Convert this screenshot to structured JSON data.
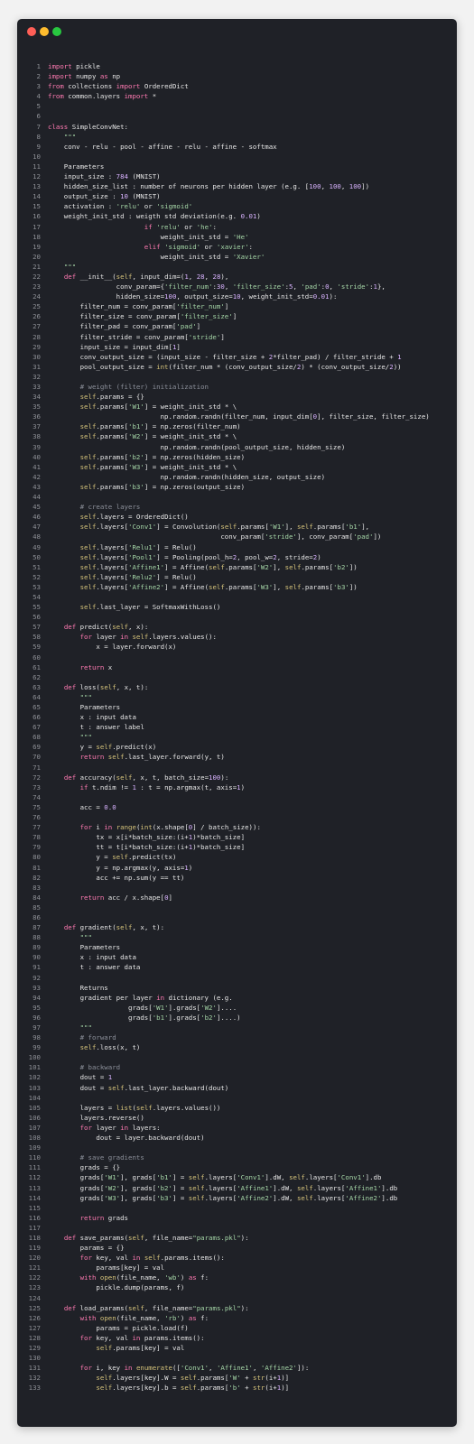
{
  "window": {
    "controls": [
      "close",
      "minimize",
      "zoom"
    ]
  },
  "code": {
    "lines": [
      "import pickle",
      "import numpy as np",
      "from collections import OrderedDict",
      "from common.layers import *",
      "",
      "",
      "class SimpleConvNet:",
      "    \"\"\"",
      "    conv - relu - pool - affine - relu - affine - softmax",
      "",
      "    Parameters",
      "    input_size : 784 (MNIST)",
      "    hidden_size_list : number of neurons per hidden layer (e.g. [100, 100, 100])",
      "    output_size : 10 (MNIST)",
      "    activation : 'relu' or 'sigmoid'",
      "    weight_init_std : weigth std deviation(e.g. 0.01)",
      "                        if 'relu' or 'he':",
      "                            weight_init_std = 'He'",
      "                        elif 'sigmoid' or 'xavier':",
      "                            weight_init_std = 'Xavier'",
      "    \"\"\"",
      "    def __init__(self, input_dim=(1, 28, 28),",
      "                 conv_param={'filter_num':30, 'filter_size':5, 'pad':0, 'stride':1},",
      "                 hidden_size=100, output_size=10, weight_init_std=0.01):",
      "        filter_num = conv_param['filter_num']",
      "        filter_size = conv_param['filter_size']",
      "        filter_pad = conv_param['pad']",
      "        filter_stride = conv_param['stride']",
      "        input_size = input_dim[1]",
      "        conv_output_size = (input_size - filter_size + 2*filter_pad) / filter_stride + 1",
      "        pool_output_size = int(filter_num * (conv_output_size/2) * (conv_output_size/2))",
      "",
      "        # weight (filter) initialization",
      "        self.params = {}",
      "        self.params['W1'] = weight_init_std * \\",
      "                            np.random.randn(filter_num, input_dim[0], filter_size, filter_size)",
      "        self.params['b1'] = np.zeros(filter_num)",
      "        self.params['W2'] = weight_init_std * \\",
      "                            np.random.randn(pool_output_size, hidden_size)",
      "        self.params['b2'] = np.zeros(hidden_size)",
      "        self.params['W3'] = weight_init_std * \\",
      "                            np.random.randn(hidden_size, output_size)",
      "        self.params['b3'] = np.zeros(output_size)",
      "",
      "        # create layers",
      "        self.layers = OrderedDict()",
      "        self.layers['Conv1'] = Convolution(self.params['W1'], self.params['b1'],",
      "                                           conv_param['stride'], conv_param['pad'])",
      "        self.layers['Relu1'] = Relu()",
      "        self.layers['Pool1'] = Pooling(pool_h=2, pool_w=2, stride=2)",
      "        self.layers['Affine1'] = Affine(self.params['W2'], self.params['b2'])",
      "        self.layers['Relu2'] = Relu()",
      "        self.layers['Affine2'] = Affine(self.params['W3'], self.params['b3'])",
      "",
      "        self.last_layer = SoftmaxWithLoss()",
      "",
      "    def predict(self, x):",
      "        for layer in self.layers.values():",
      "            x = layer.forward(x)",
      "",
      "        return x",
      "",
      "    def loss(self, x, t):",
      "        \"\"\"",
      "        Parameters",
      "        x : input data",
      "        t : answer label",
      "        \"\"\"",
      "        y = self.predict(x)",
      "        return self.last_layer.forward(y, t)",
      "",
      "    def accuracy(self, x, t, batch_size=100):",
      "        if t.ndim != 1 : t = np.argmax(t, axis=1)",
      "",
      "        acc = 0.0",
      "",
      "        for i in range(int(x.shape[0] / batch_size)):",
      "            tx = x[i*batch_size:(i+1)*batch_size]",
      "            tt = t[i*batch_size:(i+1)*batch_size]",
      "            y = self.predict(tx)",
      "            y = np.argmax(y, axis=1)",
      "            acc += np.sum(y == tt)",
      "",
      "        return acc / x.shape[0]",
      "",
      "",
      "    def gradient(self, x, t):",
      "        \"\"\"",
      "        Parameters",
      "        x : input data",
      "        t : answer data",
      "",
      "        Returns",
      "        gradient per layer in dictionary (e.g.",
      "                    grads['W1'].grads['W2']....",
      "                    grads['b1'].grads['b2']....)",
      "        \"\"\"",
      "        # forward",
      "        self.loss(x, t)",
      "",
      "        # backward",
      "        dout = 1",
      "        dout = self.last_layer.backward(dout)",
      "",
      "        layers = list(self.layers.values())",
      "        layers.reverse()",
      "        for layer in layers:",
      "            dout = layer.backward(dout)",
      "",
      "        # save gradients",
      "        grads = {}",
      "        grads['W1'], grads['b1'] = self.layers['Conv1'].dW, self.layers['Conv1'].db",
      "        grads['W2'], grads['b2'] = self.layers['Affine1'].dW, self.layers['Affine1'].db",
      "        grads['W3'], grads['b3'] = self.layers['Affine2'].dW, self.layers['Affine2'].db",
      "",
      "        return grads",
      "",
      "    def save_params(self, file_name=\"params.pkl\"):",
      "        params = {}",
      "        for key, val in self.params.items():",
      "            params[key] = val",
      "        with open(file_name, 'wb') as f:",
      "            pickle.dump(params, f)",
      "",
      "    def load_params(self, file_name=\"params.pkl\"):",
      "        with open(file_name, 'rb') as f:",
      "            params = pickle.load(f)",
      "        for key, val in params.items():",
      "            self.params[key] = val",
      "",
      "        for i, key in enumerate(['Conv1', 'Affine1', 'Affine2']):",
      "            self.layers[key].W = self.params['W' + str(i+1)]",
      "            self.layers[key].b = self.params['b' + str(i+1)]"
    ]
  }
}
